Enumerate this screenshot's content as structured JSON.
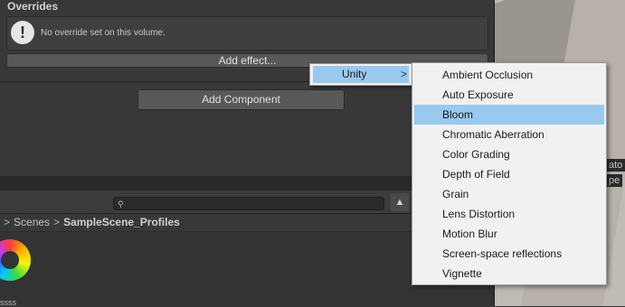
{
  "inspector": {
    "overrides_title": "Overrides",
    "help_text": "No override set on this volume.",
    "add_effect_label": "Add effect...",
    "add_component_label": "Add Component"
  },
  "project": {
    "search_value": "",
    "breadcrumb": [
      "Scenes",
      "SampleScene_Profiles"
    ],
    "asset_label": "ssss"
  },
  "scene_view": {
    "label1": "ato",
    "label2": "pe"
  },
  "menu": {
    "category": "Unity",
    "items": [
      "Ambient Occlusion",
      "Auto Exposure",
      "Bloom",
      "Chromatic Aberration",
      "Color Grading",
      "Depth of Field",
      "Grain",
      "Lens Distortion",
      "Motion Blur",
      "Screen-space reflections",
      "Vignette"
    ],
    "highlighted_item": "Bloom"
  },
  "colors": {
    "highlight": "#99c9ef",
    "menu_bg": "#f1f1f1",
    "panel_bg": "#383838"
  }
}
